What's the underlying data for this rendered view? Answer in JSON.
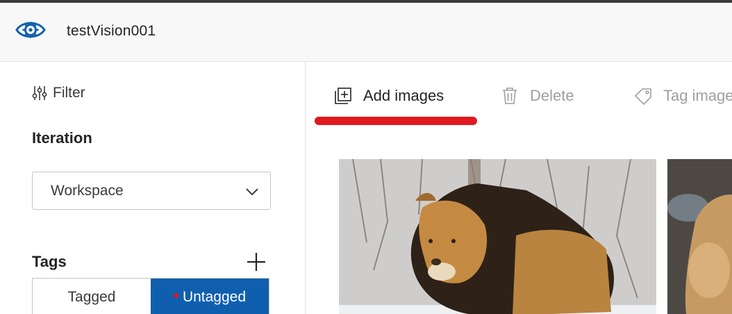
{
  "app": {
    "title": "testVision001",
    "logo_icon": "eye-gear-icon"
  },
  "sidebar": {
    "filter_label": "Filter",
    "iteration_label": "Iteration",
    "iteration_selected": "Workspace",
    "tags_label": "Tags",
    "toggle": {
      "tagged_label": "Tagged",
      "untagged_label": "Untagged",
      "active": "Untagged"
    }
  },
  "toolbar": {
    "add_images_label": "Add images",
    "delete_label": "Delete",
    "tag_images_label": "Tag images"
  },
  "images": [
    {
      "subject": "lion"
    },
    {
      "subject": "lioness"
    }
  ],
  "colors": {
    "accent": "#0f5fae",
    "highlight": "#e0191f",
    "status_dot": "#e81123"
  }
}
